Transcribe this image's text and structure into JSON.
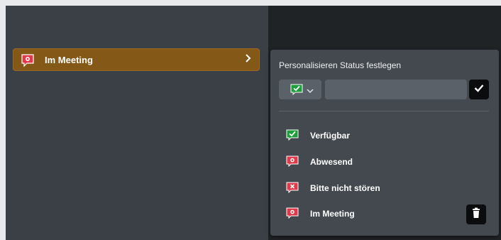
{
  "current_status": {
    "label": "Im Meeting",
    "icon": "meeting-icon",
    "background_color": "#845817"
  },
  "popup": {
    "title": "Personalisieren Status festlegen",
    "emoji_picker_icon": "available-check-icon",
    "input_value": "",
    "input_placeholder": "",
    "confirm_icon": "checkmark-icon",
    "options": [
      {
        "label": "Verfügbar",
        "icon": "available-check-icon",
        "color": "#1e9e3a"
      },
      {
        "label": "Abwesend",
        "icon": "away-icon",
        "color": "#e0394a"
      },
      {
        "label": "Bitte nicht stören",
        "icon": "dnd-x-icon",
        "color": "#e0394a"
      },
      {
        "label": "Im Meeting",
        "icon": "meeting-icon",
        "color": "#e0394a"
      }
    ],
    "delete_icon": "trash-icon"
  }
}
